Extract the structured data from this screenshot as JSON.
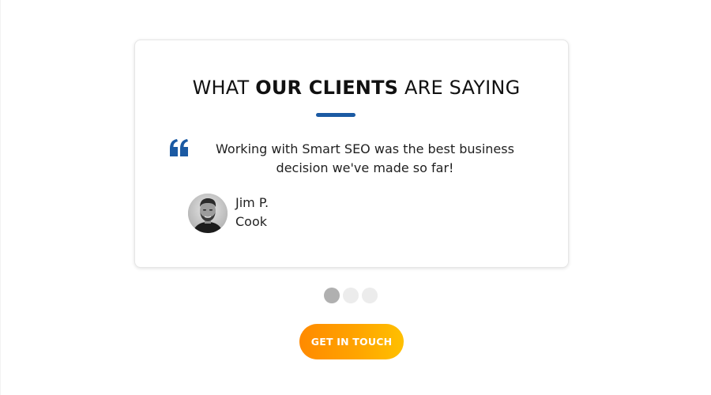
{
  "testimonials": {
    "heading": {
      "prefix": "WHAT ",
      "emphasis": "OUR CLIENTS",
      "suffix": " ARE SAYING"
    },
    "quote_text": "Working with Smart SEO was the best business decision we've made so far!",
    "author": {
      "name": "Jim P.",
      "surname": "Cook"
    },
    "slider": {
      "total": 3,
      "active_index": 0
    }
  },
  "cta": {
    "label": "GET IN TOUCH"
  },
  "colors": {
    "accent_blue": "#1b5aa3",
    "cta_gradient_start": "#ff8a00",
    "cta_gradient_end": "#ffc000",
    "dot_active": "#b0b0b0",
    "dot_inactive": "#ececec"
  },
  "icons": {
    "quote": "quote-open-icon"
  }
}
